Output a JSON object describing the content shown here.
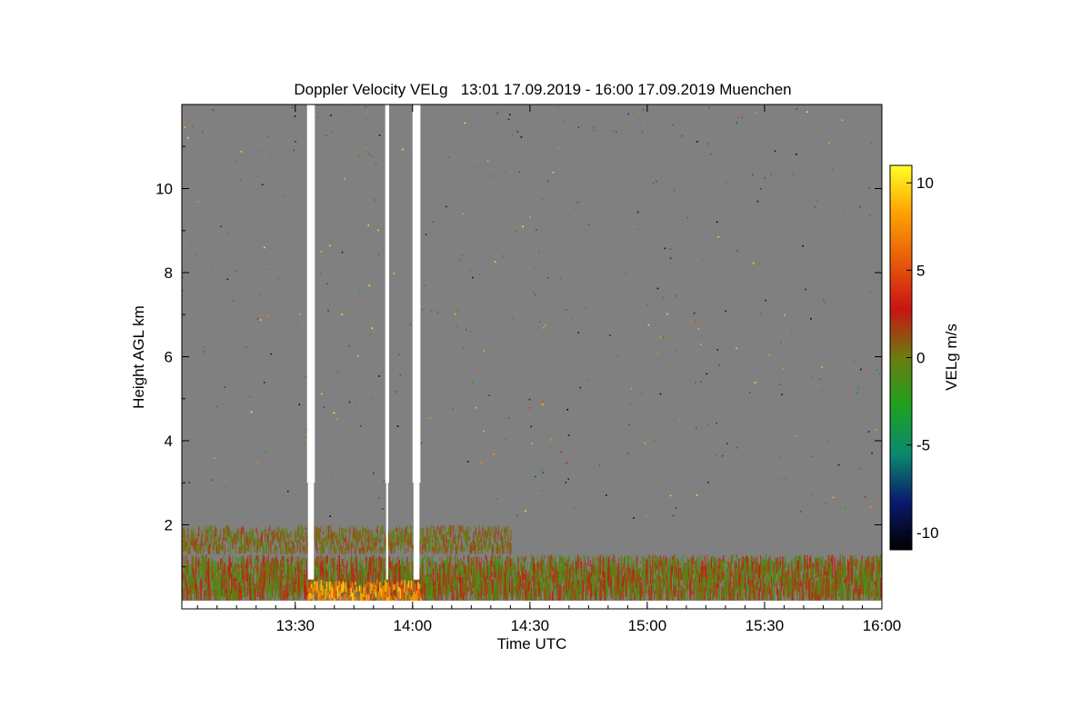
{
  "chart_data": {
    "type": "heatmap",
    "title": "Doppler Velocity VELg   13:01 17.09.2019 - 16:00 17.09.2019 Muenchen",
    "xlabel": "Time UTC",
    "ylabel": "Height AGL km",
    "colorbar_label": "VELg m/s",
    "xlim": [
      "13:01",
      "16:00"
    ],
    "ylim": [
      0,
      12
    ],
    "clim": [
      -11,
      11
    ],
    "x_ticks": [
      "13:30",
      "14:00",
      "14:30",
      "15:00",
      "15:30",
      "16:00"
    ],
    "y_ticks": [
      2,
      4,
      6,
      8,
      10
    ],
    "colorbar_ticks": [
      10,
      5,
      0,
      -5,
      -10
    ],
    "colormap": [
      "#000000",
      "#0a1a6e",
      "#0a8a6e",
      "#1fa01f",
      "#6a7d10",
      "#c81414",
      "#e85a0a",
      "#ffa000",
      "#ffff28"
    ],
    "background_color": "#808080",
    "gap_color": "#ffffff",
    "data_gaps": [
      {
        "start": "13:33",
        "end": "13:35"
      },
      {
        "start": "13:53",
        "end": "13:54"
      },
      {
        "start": "14:00",
        "end": "14:02"
      }
    ],
    "layers": [
      {
        "description": "Velocity signal in the boundary layer",
        "time_start": "13:01",
        "time_end": "16:00",
        "height_bottom_km": 0.2,
        "height_top_km": 1.3,
        "velocity_range": [
          -2,
          3
        ]
      },
      {
        "description": "Elevated layer",
        "time_start": "13:01",
        "time_end": "14:25",
        "height_bottom_km": 1.3,
        "height_top_km": 2.0,
        "velocity_range": [
          -1,
          2
        ]
      },
      {
        "description": "Downward-streaking echoes (strongly positive velocity)",
        "time_start": "13:33",
        "time_end": "14:02",
        "height_bottom_km": 0.0,
        "height_top_km": 0.7,
        "velocity_range": [
          5,
          10
        ]
      }
    ]
  }
}
